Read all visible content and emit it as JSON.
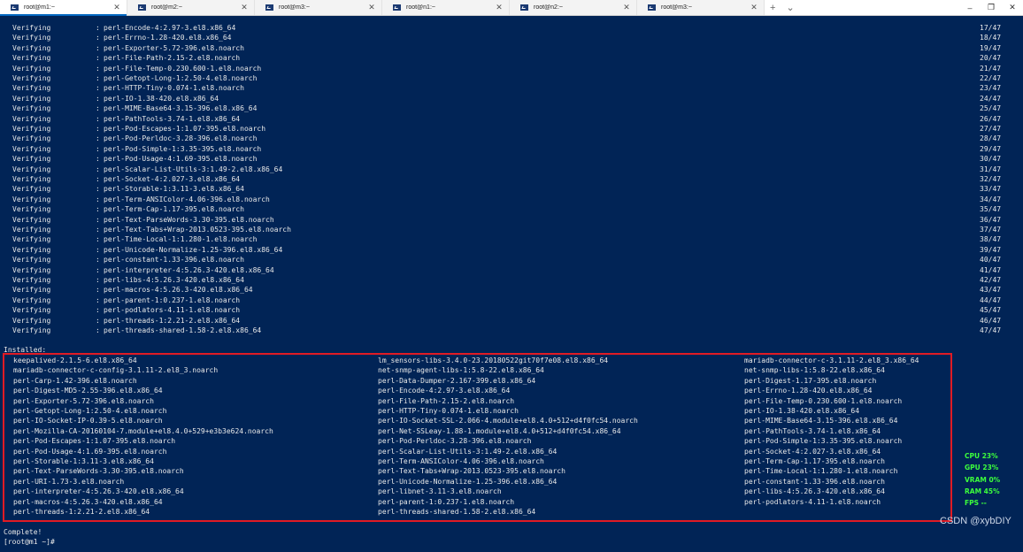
{
  "tabs": [
    {
      "label": "root@m1:~",
      "active": true
    },
    {
      "label": "root@m2:~",
      "active": false
    },
    {
      "label": "root@m3:~",
      "active": false
    },
    {
      "label": "root@n1:~",
      "active": false
    },
    {
      "label": "root@n2:~",
      "active": false
    },
    {
      "label": "root@m3:~",
      "active": false
    }
  ],
  "tab_controls": {
    "new_tab": "+",
    "dropdown": "⌄"
  },
  "window_controls": {
    "minimize": "–",
    "maximize": "❐",
    "close": "✕"
  },
  "terminal": {
    "background": "#012456",
    "verifying": [
      {
        "label": "Verifying",
        "pkg": "perl-Encode-4:2.97-3.el8.x86_64",
        "count": "17/47"
      },
      {
        "label": "Verifying",
        "pkg": "perl-Errno-1.28-420.el8.x86_64",
        "count": "18/47"
      },
      {
        "label": "Verifying",
        "pkg": "perl-Exporter-5.72-396.el8.noarch",
        "count": "19/47"
      },
      {
        "label": "Verifying",
        "pkg": "perl-File-Path-2.15-2.el8.noarch",
        "count": "20/47"
      },
      {
        "label": "Verifying",
        "pkg": "perl-File-Temp-0.230.600-1.el8.noarch",
        "count": "21/47"
      },
      {
        "label": "Verifying",
        "pkg": "perl-Getopt-Long-1:2.50-4.el8.noarch",
        "count": "22/47"
      },
      {
        "label": "Verifying",
        "pkg": "perl-HTTP-Tiny-0.074-1.el8.noarch",
        "count": "23/47"
      },
      {
        "label": "Verifying",
        "pkg": "perl-IO-1.38-420.el8.x86_64",
        "count": "24/47"
      },
      {
        "label": "Verifying",
        "pkg": "perl-MIME-Base64-3.15-396.el8.x86_64",
        "count": "25/47"
      },
      {
        "label": "Verifying",
        "pkg": "perl-PathTools-3.74-1.el8.x86_64",
        "count": "26/47"
      },
      {
        "label": "Verifying",
        "pkg": "perl-Pod-Escapes-1:1.07-395.el8.noarch",
        "count": "27/47"
      },
      {
        "label": "Verifying",
        "pkg": "perl-Pod-Perldoc-3.28-396.el8.noarch",
        "count": "28/47"
      },
      {
        "label": "Verifying",
        "pkg": "perl-Pod-Simple-1:3.35-395.el8.noarch",
        "count": "29/47"
      },
      {
        "label": "Verifying",
        "pkg": "perl-Pod-Usage-4:1.69-395.el8.noarch",
        "count": "30/47"
      },
      {
        "label": "Verifying",
        "pkg": "perl-Scalar-List-Utils-3:1.49-2.el8.x86_64",
        "count": "31/47"
      },
      {
        "label": "Verifying",
        "pkg": "perl-Socket-4:2.027-3.el8.x86_64",
        "count": "32/47"
      },
      {
        "label": "Verifying",
        "pkg": "perl-Storable-1:3.11-3.el8.x86_64",
        "count": "33/47"
      },
      {
        "label": "Verifying",
        "pkg": "perl-Term-ANSIColor-4.06-396.el8.noarch",
        "count": "34/47"
      },
      {
        "label": "Verifying",
        "pkg": "perl-Term-Cap-1.17-395.el8.noarch",
        "count": "35/47"
      },
      {
        "label": "Verifying",
        "pkg": "perl-Text-ParseWords-3.30-395.el8.noarch",
        "count": "36/47"
      },
      {
        "label": "Verifying",
        "pkg": "perl-Text-Tabs+Wrap-2013.0523-395.el8.noarch",
        "count": "37/47"
      },
      {
        "label": "Verifying",
        "pkg": "perl-Time-Local-1:1.280-1.el8.noarch",
        "count": "38/47"
      },
      {
        "label": "Verifying",
        "pkg": "perl-Unicode-Normalize-1.25-396.el8.x86_64",
        "count": "39/47"
      },
      {
        "label": "Verifying",
        "pkg": "perl-constant-1.33-396.el8.noarch",
        "count": "40/47"
      },
      {
        "label": "Verifying",
        "pkg": "perl-interpreter-4:5.26.3-420.el8.x86_64",
        "count": "41/47"
      },
      {
        "label": "Verifying",
        "pkg": "perl-libs-4:5.26.3-420.el8.x86_64",
        "count": "42/47"
      },
      {
        "label": "Verifying",
        "pkg": "perl-macros-4:5.26.3-420.el8.x86_64",
        "count": "43/47"
      },
      {
        "label": "Verifying",
        "pkg": "perl-parent-1:0.237-1.el8.noarch",
        "count": "44/47"
      },
      {
        "label": "Verifying",
        "pkg": "perl-podlators-4.11-1.el8.noarch",
        "count": "45/47"
      },
      {
        "label": "Verifying",
        "pkg": "perl-threads-1:2.21-2.el8.x86_64",
        "count": "46/47"
      },
      {
        "label": "Verifying",
        "pkg": "perl-threads-shared-1.58-2.el8.x86_64",
        "count": "47/47"
      }
    ],
    "installed_header": "Installed:",
    "installed": [
      [
        "keepalived-2.1.5-6.el8.x86_64",
        "lm_sensors-libs-3.4.0-23.20180522git70f7e08.el8.x86_64",
        "mariadb-connector-c-3.1.11-2.el8_3.x86_64"
      ],
      [
        "mariadb-connector-c-config-3.1.11-2.el8_3.noarch",
        "net-snmp-agent-libs-1:5.8-22.el8.x86_64",
        "net-snmp-libs-1:5.8-22.el8.x86_64"
      ],
      [
        "perl-Carp-1.42-396.el8.noarch",
        "perl-Data-Dumper-2.167-399.el8.x86_64",
        "perl-Digest-1.17-395.el8.noarch"
      ],
      [
        "perl-Digest-MD5-2.55-396.el8.x86_64",
        "perl-Encode-4:2.97-3.el8.x86_64",
        "perl-Errno-1.28-420.el8.x86_64"
      ],
      [
        "perl-Exporter-5.72-396.el8.noarch",
        "perl-File-Path-2.15-2.el8.noarch",
        "perl-File-Temp-0.230.600-1.el8.noarch"
      ],
      [
        "perl-Getopt-Long-1:2.50-4.el8.noarch",
        "perl-HTTP-Tiny-0.074-1.el8.noarch",
        "perl-IO-1.38-420.el8.x86_64"
      ],
      [
        "perl-IO-Socket-IP-0.39-5.el8.noarch",
        "perl-IO-Socket-SSL-2.066-4.module+el8.4.0+512+d4f0fc54.noarch",
        "perl-MIME-Base64-3.15-396.el8.x86_64"
      ],
      [
        "perl-Mozilla-CA-20160104-7.module+el8.4.0+529+e3b3e624.noarch",
        "perl-Net-SSLeay-1.88-1.module+el8.4.0+512+d4f0fc54.x86_64",
        "perl-PathTools-3.74-1.el8.x86_64"
      ],
      [
        "perl-Pod-Escapes-1:1.07-395.el8.noarch",
        "perl-Pod-Perldoc-3.28-396.el8.noarch",
        "perl-Pod-Simple-1:3.35-395.el8.noarch"
      ],
      [
        "perl-Pod-Usage-4:1.69-395.el8.noarch",
        "perl-Scalar-List-Utils-3:1.49-2.el8.x86_64",
        "perl-Socket-4:2.027-3.el8.x86_64"
      ],
      [
        "perl-Storable-1:3.11-3.el8.x86_64",
        "perl-Term-ANSIColor-4.06-396.el8.noarch",
        "perl-Term-Cap-1.17-395.el8.noarch"
      ],
      [
        "perl-Text-ParseWords-3.30-395.el8.noarch",
        "perl-Text-Tabs+Wrap-2013.0523-395.el8.noarch",
        "perl-Time-Local-1:1.280-1.el8.noarch"
      ],
      [
        "perl-URI-1.73-3.el8.noarch",
        "perl-Unicode-Normalize-1.25-396.el8.x86_64",
        "perl-constant-1.33-396.el8.noarch"
      ],
      [
        "perl-interpreter-4:5.26.3-420.el8.x86_64",
        "perl-libnet-3.11-3.el8.noarch",
        "perl-libs-4:5.26.3-420.el8.x86_64"
      ],
      [
        "perl-macros-4:5.26.3-420.el8.x86_64",
        "perl-parent-1:0.237-1.el8.noarch",
        "perl-podlators-4.11-1.el8.noarch"
      ],
      [
        "perl-threads-1:2.21-2.el8.x86_64",
        "perl-threads-shared-1.58-2.el8.x86_64",
        ""
      ]
    ],
    "complete": "Complete!",
    "prompt": "[root@m1 ~]#"
  },
  "stats": {
    "cpu": "CPU 23%",
    "gpu": "GPU 23%",
    "vram": "VRAM  0%",
    "ram": "RAM 45%",
    "fps": "FPS --",
    "color": "#3cff3c"
  },
  "watermark": "CSDN @xybDIY"
}
